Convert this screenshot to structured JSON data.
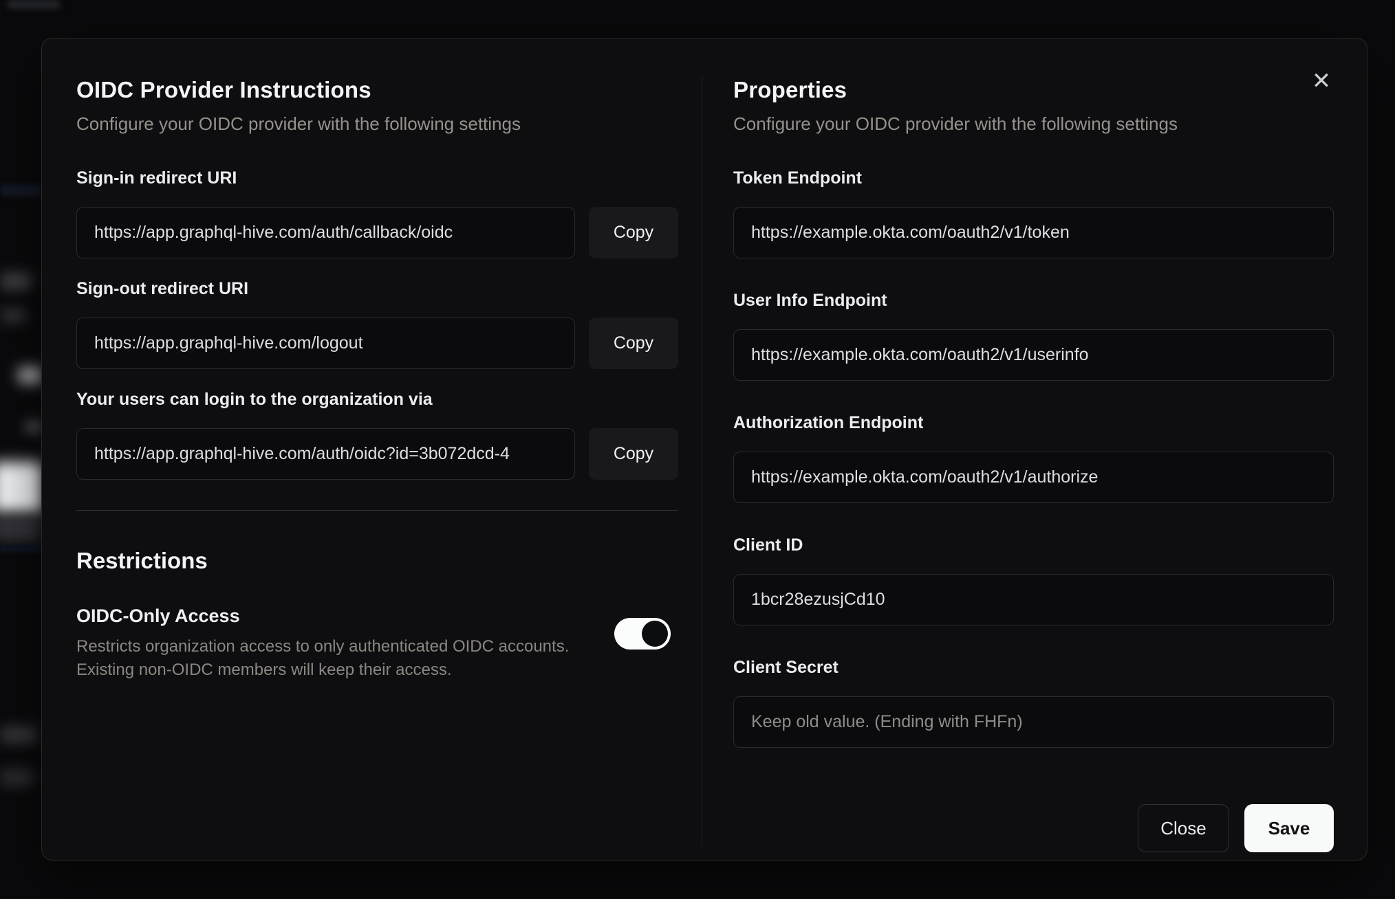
{
  "modal": {
    "close_icon": "✕",
    "left": {
      "title": "OIDC Provider Instructions",
      "subtitle": "Configure your OIDC provider with the following settings",
      "fields": [
        {
          "label": "Sign-in redirect URI",
          "value": "https://app.graphql-hive.com/auth/callback/oidc",
          "copy_label": "Copy"
        },
        {
          "label": "Sign-out redirect URI",
          "value": "https://app.graphql-hive.com/logout",
          "copy_label": "Copy"
        },
        {
          "label": "Your users can login to the organization via",
          "value": "https://app.graphql-hive.com/auth/oidc?id=3b072dcd-4",
          "copy_label": "Copy"
        }
      ],
      "restrictions": {
        "title": "Restrictions",
        "toggle_label": "OIDC-Only Access",
        "description_line1": "Restricts organization access to only authenticated OIDC accounts.",
        "description_line2": "Existing non-OIDC members will keep their access.",
        "toggle_state": "on"
      }
    },
    "right": {
      "title": "Properties",
      "subtitle": "Configure your OIDC provider with the following settings",
      "fields": [
        {
          "label": "Token Endpoint",
          "value": "https://example.okta.com/oauth2/v1/token"
        },
        {
          "label": "User Info Endpoint",
          "value": "https://example.okta.com/oauth2/v1/userinfo"
        },
        {
          "label": "Authorization Endpoint",
          "value": "https://example.okta.com/oauth2/v1/authorize"
        },
        {
          "label": "Client ID",
          "value": "1bcr28ezusjCd10"
        },
        {
          "label": "Client Secret",
          "value": "",
          "placeholder": "Keep old value. (Ending with FHFn)"
        }
      ],
      "footer": {
        "close_label": "Close",
        "save_label": "Save"
      }
    }
  },
  "colors": {
    "page_background": "#0a0a0c",
    "modal_background": "#0e0e11",
    "modal_border": "#2b2927",
    "input_border": "#2a2a2d",
    "copy_button_background": "#19191c",
    "primary_button_background": "#f8f9f9",
    "primary_button_text": "#121215",
    "toggle_track_on": "#fbfcfc",
    "toggle_thumb": "#0c0d10",
    "muted_text": "#96918b",
    "label_text": "#eaecee"
  }
}
